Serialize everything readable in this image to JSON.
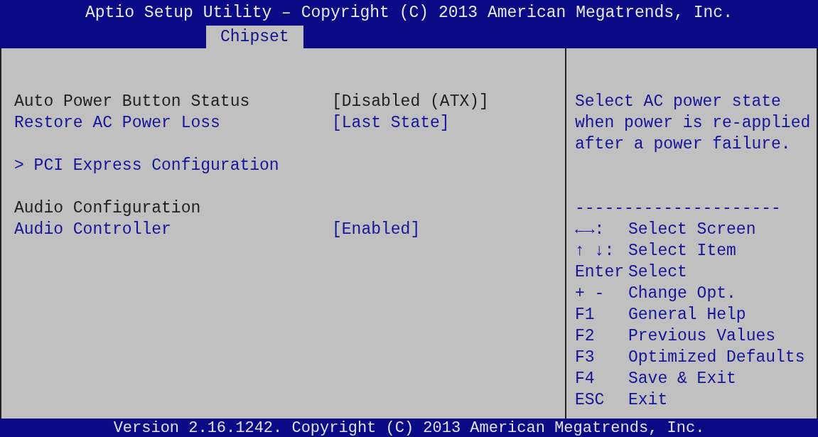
{
  "title": "Aptio Setup Utility – Copyright (C) 2013 American Megatrends, Inc.",
  "tabs": [
    {
      "label": "Chipset",
      "selected": true
    }
  ],
  "groups": [
    {
      "items": [
        {
          "kind": "setting",
          "label": "Auto Power Button Status",
          "value": "[Disabled (ATX)]",
          "editable": false
        },
        {
          "kind": "setting",
          "label": "Restore AC Power Loss",
          "value": "[Last State]",
          "editable": true
        }
      ]
    },
    {
      "items": [
        {
          "kind": "submenu",
          "label": "> PCI Express Configuration",
          "editable": true
        }
      ]
    },
    {
      "items": [
        {
          "kind": "heading",
          "label": "Audio Configuration",
          "editable": false
        },
        {
          "kind": "setting",
          "label": "Audio Controller",
          "value": "[Enabled]",
          "editable": true
        }
      ]
    }
  ],
  "help_text": [
    "Select AC power state",
    "when power is re-applied",
    "after a power failure."
  ],
  "separator": "---------------------",
  "legend": [
    {
      "key": "←→:",
      "action": "Select Screen"
    },
    {
      "key": "↑ ↓:",
      "action": "Select Item"
    },
    {
      "key": "Enter",
      "action": "Select"
    },
    {
      "key": "+ -",
      "action": "Change Opt."
    },
    {
      "key": "F1",
      "action": "General Help"
    },
    {
      "key": "F2",
      "action": "Previous Values"
    },
    {
      "key": "F3",
      "action": "Optimized Defaults"
    },
    {
      "key": "F4",
      "action": "Save & Exit"
    },
    {
      "key": "ESC",
      "action": "Exit"
    }
  ],
  "footer": "Version 2.16.1242. Copyright (C) 2013 American Megatrends, Inc."
}
